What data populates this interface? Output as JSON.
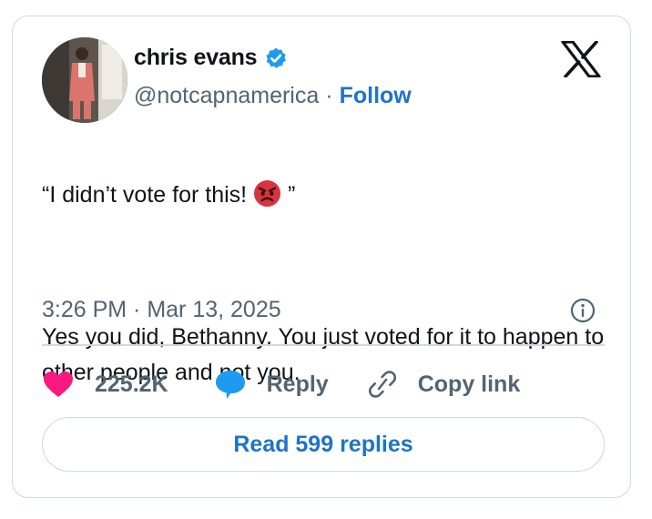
{
  "author": {
    "name": "chris evans",
    "handle": "@notcapnamerica",
    "separator": "·",
    "follow_label": "Follow",
    "verified": true
  },
  "tweet": {
    "line1_prefix": "“I didn’t vote for this! ",
    "line1_emoji": "angry-face-emoji",
    "line1_suffix": " ”",
    "body": "Yes you did, Bethanny. You just voted for it to happen to other people and not you.",
    "timestamp": "3:26 PM · Mar 13, 2025"
  },
  "actions": {
    "likes_count": "225.2K",
    "reply_label": "Reply",
    "copy_link_label": "Copy link"
  },
  "read_replies_label": "Read 599 replies",
  "icons": {
    "brand": "x-logo-icon",
    "verified": "verified-badge-icon",
    "info": "info-icon",
    "like": "heart-icon",
    "reply": "speech-bubble-icon",
    "copy": "link-icon"
  },
  "colors": {
    "link_blue": "#1d74c9",
    "secondary_text": "#536471",
    "border": "#cfd9de",
    "heart": "#f91880",
    "reply_bubble": "#1d9bf0",
    "verified": "#1d9bf0",
    "angry_emoji": "#d8343f"
  }
}
